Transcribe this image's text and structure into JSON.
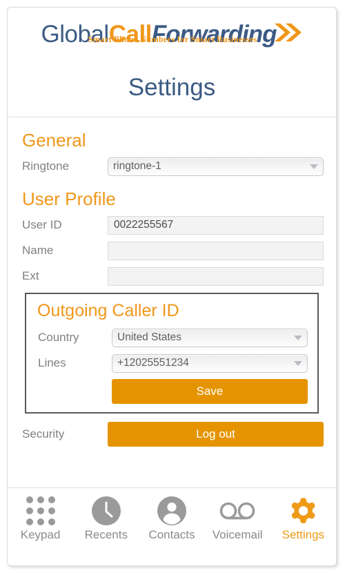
{
  "brand": {
    "logo_part1": "Global",
    "logo_part2": "Call",
    "logo_part3": "Forwarding",
    "tagline": "Smart Phone Numbers for Smart Businesses",
    "chevron_icon": "double-chevron-right-icon",
    "color_blue": "#3B5A84",
    "color_orange": "#F0971B"
  },
  "header": {
    "title": "Settings"
  },
  "general": {
    "heading": "General",
    "ringtone": {
      "label": "Ringtone",
      "value": "ringtone-1",
      "caret_icon": "chevron-down-icon"
    }
  },
  "user_profile": {
    "heading": "User Profile",
    "fields": [
      {
        "label": "User ID",
        "value": "0022255567",
        "placeholder": ""
      },
      {
        "label": "Name",
        "value": "",
        "placeholder": ""
      },
      {
        "label": "Ext",
        "value": "",
        "placeholder": ""
      }
    ]
  },
  "caller_id": {
    "heading": "Outgoing Caller ID",
    "country": {
      "label": "Country",
      "value": "United States"
    },
    "lines": {
      "label": "Lines",
      "value": "+12025551234"
    },
    "save_label": "Save"
  },
  "security": {
    "label": "Security",
    "logout_label": "Log out"
  },
  "bottom_nav": {
    "items": [
      {
        "label": "Keypad",
        "icon": "keypad-dots-icon",
        "active": false
      },
      {
        "label": "Recents",
        "icon": "clock-icon",
        "active": false
      },
      {
        "label": "Contacts",
        "icon": "person-icon",
        "active": false
      },
      {
        "label": "Voicemail",
        "icon": "voicemail-icon",
        "active": false
      },
      {
        "label": "Settings",
        "icon": "gear-icon",
        "active": true
      }
    ],
    "inactive_color": "#9a9a9a",
    "active_color": "#EE9A16"
  }
}
